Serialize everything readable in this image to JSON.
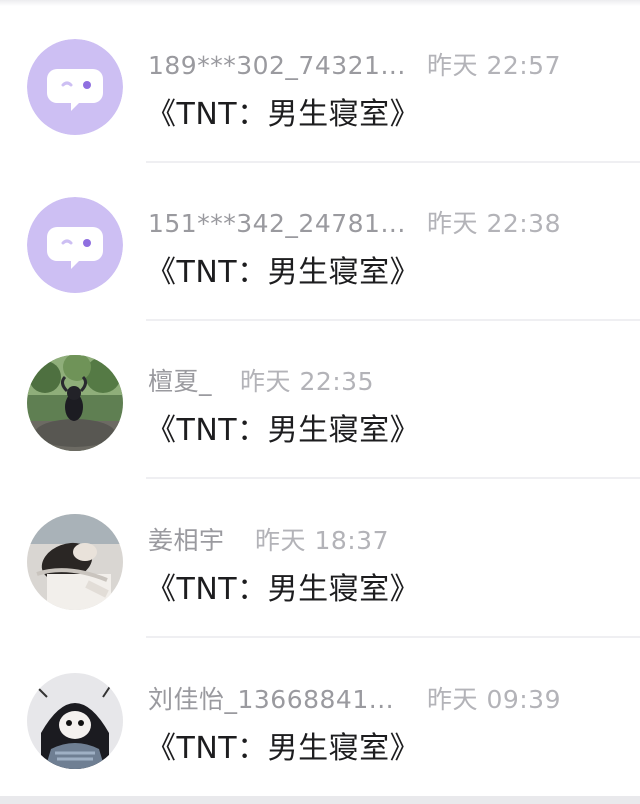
{
  "comments": [
    {
      "username": "189***302_74321...",
      "time": "昨天 22:57",
      "message": "《TNT：男生寝室》",
      "avatar": "default-chat-bubble-avatar"
    },
    {
      "username": "151***342_24781...",
      "time": "昨天 22:38",
      "message": "《TNT：男生寝室》",
      "avatar": "default-chat-bubble-avatar"
    },
    {
      "username": "檀夏_",
      "time": "昨天 22:35",
      "message": "《TNT：男生寝室》",
      "avatar": "photo-person-in-forest"
    },
    {
      "username": "姜相宇",
      "time": "昨天 18:37",
      "message": "《TNT：男生寝室》",
      "avatar": "photo-person-lying-down"
    },
    {
      "username": "刘佳怡_13668841...",
      "time": "昨天 09:39",
      "message": "《TNT：男生寝室》",
      "avatar": "anime-illustration-avatar"
    }
  ],
  "colors": {
    "default_avatar_bg": "#cdbff3",
    "name_text": "#9a9a9f",
    "time_text": "#b3b3b8",
    "message_text": "#1d1d1f"
  }
}
